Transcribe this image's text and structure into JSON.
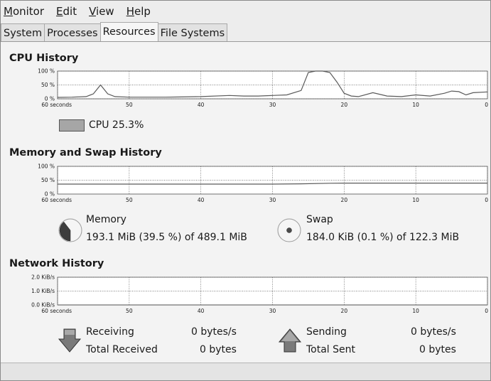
{
  "menubar": {
    "items": [
      {
        "mnemonic": "M",
        "rest": "onitor"
      },
      {
        "mnemonic": "E",
        "rest": "dit"
      },
      {
        "mnemonic": "V",
        "rest": "iew"
      },
      {
        "mnemonic": "H",
        "rest": "elp"
      }
    ]
  },
  "tabs": [
    {
      "label": "System"
    },
    {
      "label": "Processes"
    },
    {
      "label": "Resources"
    },
    {
      "label": "File Systems"
    }
  ],
  "active_tab": "Resources",
  "cpu": {
    "title": "CPU History",
    "y_ticks": [
      "100 %",
      "50 %",
      "0 %"
    ],
    "x_ticks": [
      "60 seconds",
      "50",
      "40",
      "30",
      "20",
      "10",
      "0"
    ],
    "legend_label": "CPU 25.3%"
  },
  "memory": {
    "title": "Memory and Swap History",
    "y_ticks": [
      "100 %",
      "50 %",
      "0 %"
    ],
    "x_ticks": [
      "60 seconds",
      "50",
      "40",
      "30",
      "20",
      "10",
      "0"
    ],
    "memory_label": "Memory",
    "memory_value": "193.1 MiB (39.5 %) of 489.1 MiB",
    "swap_label": "Swap",
    "swap_value": "184.0 KiB (0.1 %) of 122.3 MiB"
  },
  "network": {
    "title": "Network History",
    "y_ticks": [
      "2.0 KiB/s",
      "1.0 KiB/s",
      "0.0 KiB/s"
    ],
    "x_ticks": [
      "60 seconds",
      "50",
      "40",
      "30",
      "20",
      "10",
      "0"
    ],
    "receiving_label": "Receiving",
    "receiving_value": "0 bytes/s",
    "total_received_label": "Total Received",
    "total_received_value": "0 bytes",
    "sending_label": "Sending",
    "sending_value": "0 bytes/s",
    "total_sent_label": "Total Sent",
    "total_sent_value": "0 bytes"
  },
  "chart_data": [
    {
      "type": "line",
      "title": "CPU History",
      "ylim": [
        0,
        100
      ],
      "x": [
        60,
        58,
        56,
        55,
        54,
        53,
        52,
        50,
        45,
        40,
        36,
        34,
        32,
        30,
        28,
        26,
        25,
        24,
        23,
        22,
        21,
        20,
        19,
        18,
        16,
        14,
        12,
        10,
        8,
        6,
        5,
        4,
        3,
        2,
        0
      ],
      "series": [
        {
          "values": [
            5,
            6,
            8,
            18,
            50,
            18,
            8,
            6,
            6,
            8,
            12,
            10,
            10,
            12,
            14,
            30,
            95,
            100,
            100,
            95,
            60,
            20,
            10,
            8,
            22,
            10,
            8,
            14,
            10,
            20,
            28,
            26,
            14,
            22,
            25
          ]
        }
      ],
      "color": "#5f5f5f"
    },
    {
      "type": "line",
      "title": "Memory and Swap History",
      "ylim": [
        0,
        100
      ],
      "x": [
        60,
        50,
        40,
        30,
        26,
        22,
        20,
        10,
        0
      ],
      "series": [
        {
          "name": "Memory",
          "values": [
            36,
            36,
            36,
            36,
            37,
            39,
            39.5,
            39.5,
            39.5
          ]
        },
        {
          "name": "Swap",
          "values": [
            0.1,
            0.1,
            0.1,
            0.1,
            0.1,
            0.1,
            0.1,
            0.1,
            0.1
          ]
        }
      ]
    },
    {
      "type": "line",
      "title": "Network History",
      "ylim": [
        0,
        2
      ],
      "x": [
        60,
        0
      ],
      "series": [
        {
          "name": "Receiving",
          "values": [
            0,
            0
          ]
        },
        {
          "name": "Sending",
          "values": [
            0,
            0
          ]
        }
      ]
    }
  ]
}
